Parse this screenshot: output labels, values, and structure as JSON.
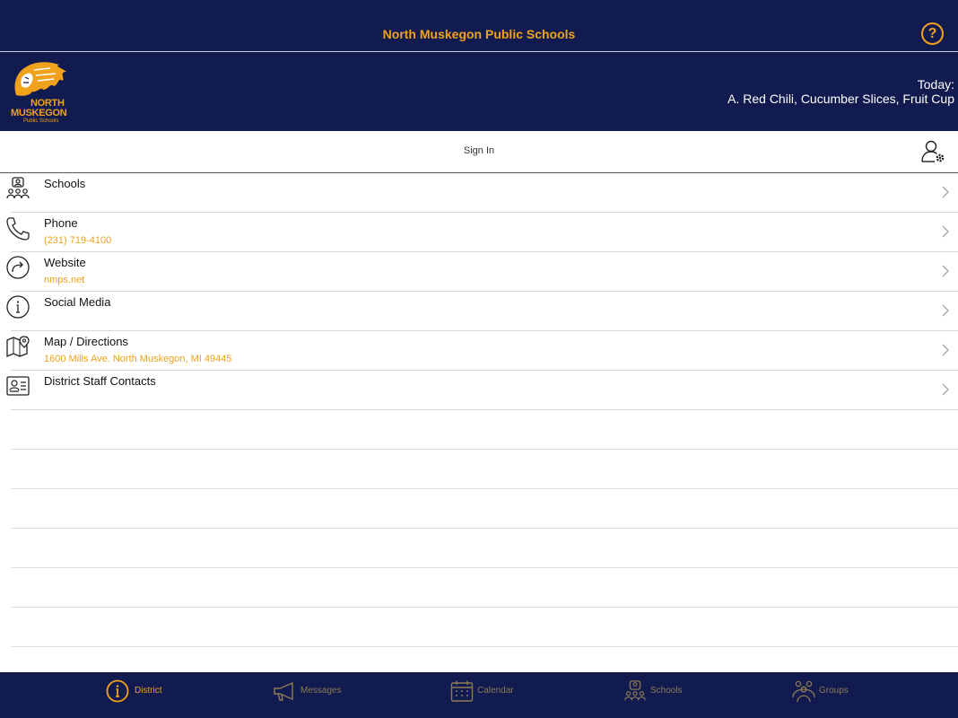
{
  "app": {
    "title": "North Muskegon Public Schools"
  },
  "logo": {
    "line1": "NORTH",
    "line2": "MUSKEGON",
    "line3": "Public Schools"
  },
  "menu": {
    "label": "Today:",
    "items": "A. Red Chili, Cucumber Slices, Fruit Cup"
  },
  "signin": {
    "label": "Sign In"
  },
  "rows": [
    {
      "label": "Schools",
      "sub": "",
      "icon": "people-group-icon"
    },
    {
      "label": "Phone",
      "sub": "(231) 719-4100",
      "icon": "phone-icon"
    },
    {
      "label": "Website",
      "sub": "nmps.net",
      "icon": "share-arrow-icon"
    },
    {
      "label": "Social Media",
      "sub": "",
      "icon": "info-icon"
    },
    {
      "label": "Map / Directions",
      "sub": "1600 Mills Ave. North Muskegon, MI 49445",
      "icon": "map-pin-icon"
    },
    {
      "label": "District Staff Contacts",
      "sub": "",
      "icon": "contact-card-icon"
    }
  ],
  "tabs": [
    {
      "label": "District",
      "icon": "info-icon",
      "active": true
    },
    {
      "label": "Messages",
      "icon": "megaphone-icon",
      "active": false
    },
    {
      "label": "Calendar",
      "icon": "calendar-icon",
      "active": false
    },
    {
      "label": "Schools",
      "icon": "people-group-icon",
      "active": false
    },
    {
      "label": "Groups",
      "icon": "groups-icon",
      "active": false
    }
  ],
  "colors": {
    "navy": "#111b4f",
    "accent": "#f0a21c",
    "muted_tab": "#8d7a55"
  }
}
